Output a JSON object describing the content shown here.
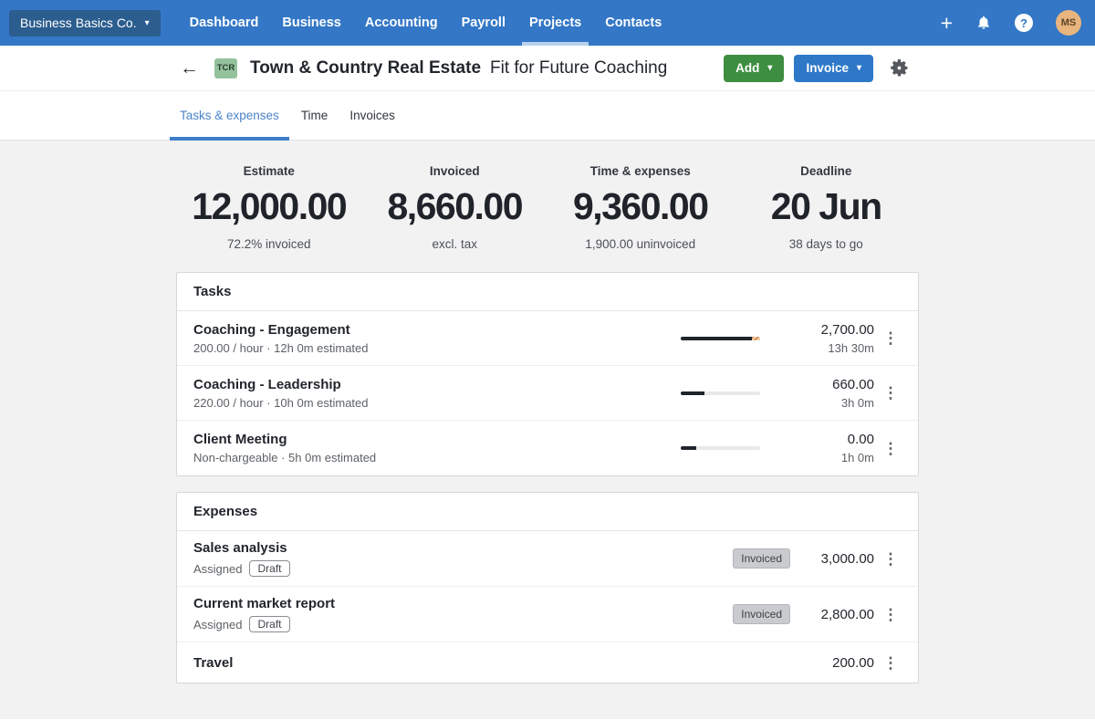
{
  "topnav": {
    "org_label": "Business Basics Co.",
    "items": [
      {
        "label": "Dashboard",
        "active": false
      },
      {
        "label": "Business",
        "active": false
      },
      {
        "label": "Accounting",
        "active": false
      },
      {
        "label": "Payroll",
        "active": false
      },
      {
        "label": "Projects",
        "active": true
      },
      {
        "label": "Contacts",
        "active": false
      }
    ],
    "avatar_initials": "MS"
  },
  "icons": {
    "plus": "+",
    "caret": "▾",
    "back_arrow": "←",
    "kebab": "⋮",
    "help": "?"
  },
  "header": {
    "badge": "TCR",
    "project_name": "Town & Country Real Estate",
    "project_subtitle": "Fit for Future Coaching",
    "add_label": "Add",
    "invoice_label": "Invoice"
  },
  "tabs": [
    {
      "label": "Tasks & expenses",
      "active": true
    },
    {
      "label": "Time",
      "active": false
    },
    {
      "label": "Invoices",
      "active": false
    }
  ],
  "summary": [
    {
      "label": "Estimate",
      "value": "12,000.00",
      "sub": "72.2% invoiced"
    },
    {
      "label": "Invoiced",
      "value": "8,660.00",
      "sub": "excl. tax"
    },
    {
      "label": "Time & expenses",
      "value": "9,360.00",
      "sub": "1,900.00 uninvoiced"
    },
    {
      "label": "Deadline",
      "value": "20 Jun",
      "sub": "38 days to go"
    }
  ],
  "tasks": {
    "title": "Tasks",
    "rows": [
      {
        "name": "Coaching - Engagement",
        "detail": "200.00 / hour · 12h 0m estimated",
        "amount": "2,700.00",
        "time": "13h 30m",
        "progress_pct": 90,
        "overflow_pct": 10
      },
      {
        "name": "Coaching - Leadership",
        "detail": "220.00 / hour · 10h 0m estimated",
        "amount": "660.00",
        "time": "3h 0m",
        "progress_pct": 30,
        "overflow_pct": 0
      },
      {
        "name": "Client Meeting",
        "detail": "Non-chargeable · 5h 0m estimated",
        "amount": "0.00",
        "time": "1h 0m",
        "progress_pct": 20,
        "overflow_pct": 0
      }
    ]
  },
  "expenses": {
    "title": "Expenses",
    "rows": [
      {
        "name": "Sales analysis",
        "assigned": "Assigned",
        "draft": "Draft",
        "invoiced": "Invoiced",
        "amount": "3,000.00"
      },
      {
        "name": "Current market report",
        "assigned": "Assigned",
        "draft": "Draft",
        "invoiced": "Invoiced",
        "amount": "2,800.00"
      },
      {
        "name": "Travel",
        "amount": "200.00"
      }
    ]
  },
  "colors": {
    "nav_blue": "#3377c6",
    "org_box_blue": "#2b5d8e",
    "nav_active_underline": "#b7d2ee",
    "add_green": "#3e8e41",
    "invoice_blue": "#2e78c8",
    "tab_active_blue": "#3d7ec9",
    "project_badge_green": "#94c29d",
    "avatar_orange": "#e9b57f",
    "progress_dark": "#20242b",
    "progress_overflow_orange": "#cf8a50",
    "content_bg": "#f2f2f3"
  }
}
